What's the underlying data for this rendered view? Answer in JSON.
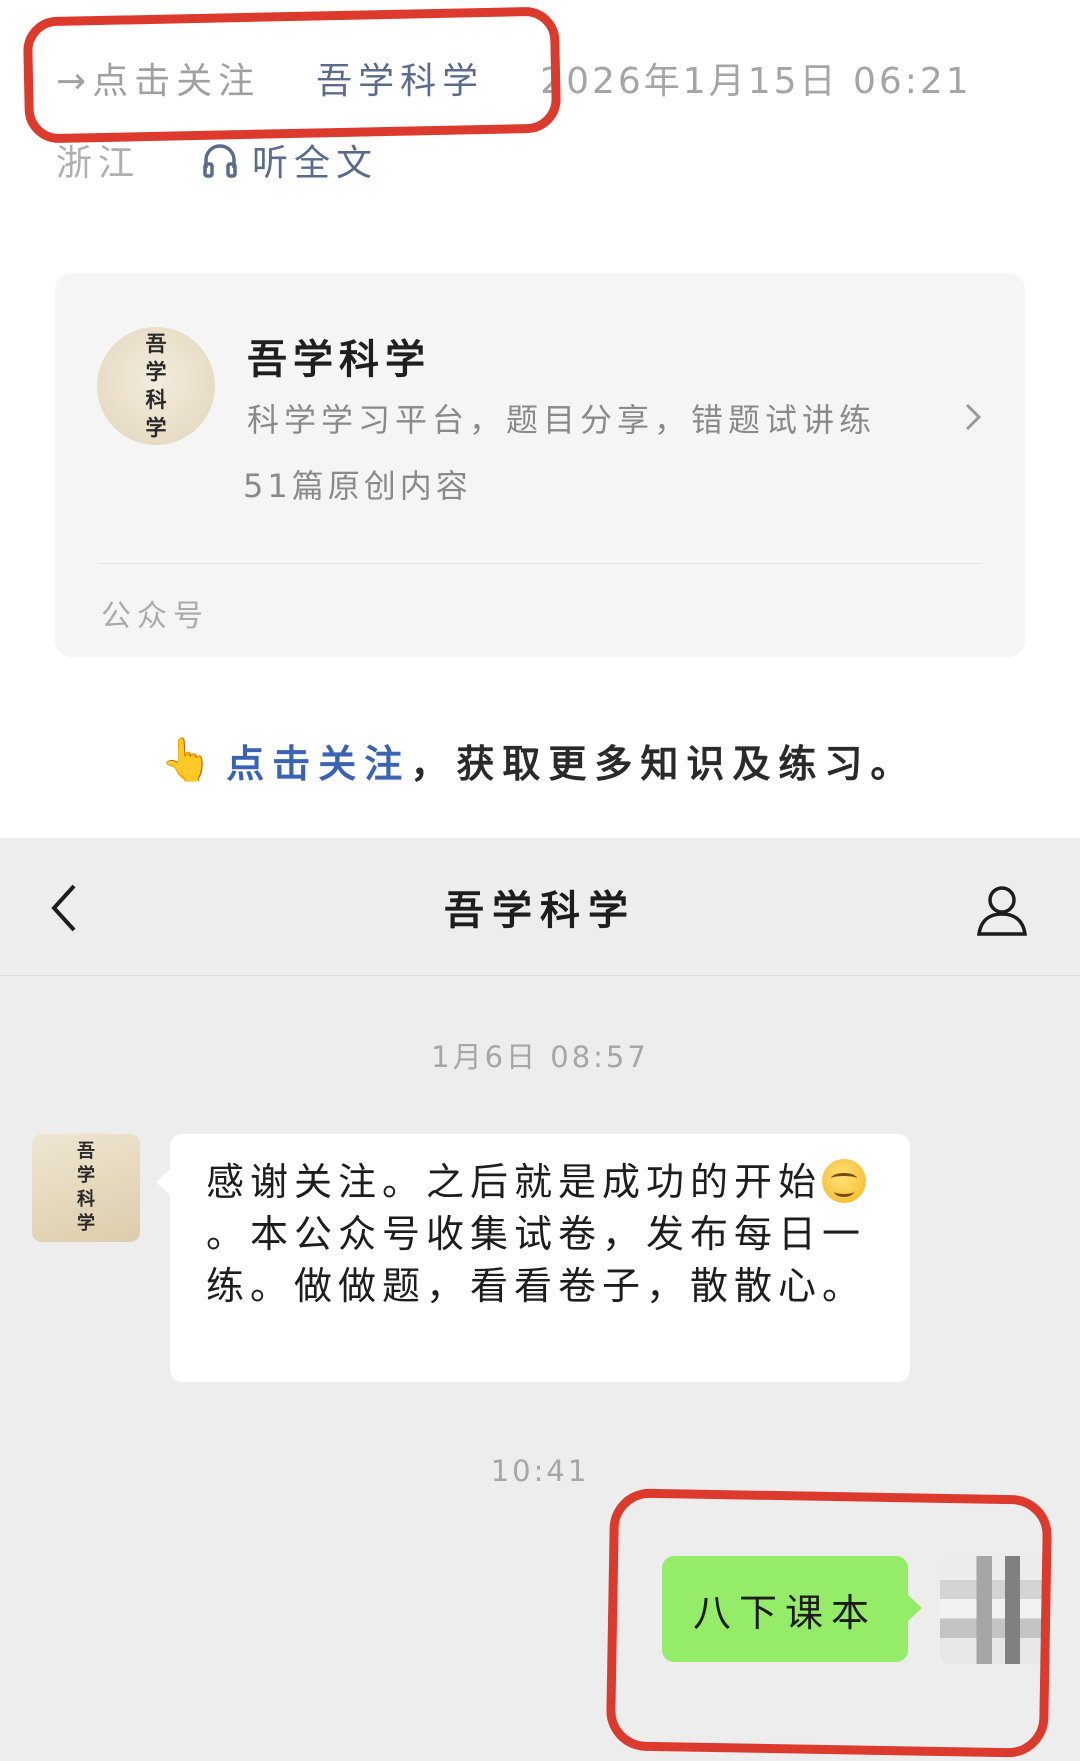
{
  "article": {
    "follow_link": "→点击关注",
    "account_name": "吾学科学",
    "date": "2026年1月15日 06:21",
    "region": "浙江",
    "listen_label": "听全文"
  },
  "card": {
    "avatar_chars": [
      "吾",
      "学",
      "科",
      "学"
    ],
    "name": "吾学科学",
    "description": "科学学习平台，题目分享，错题试讲练",
    "count": "51篇原创内容",
    "type": "公众号"
  },
  "cta": {
    "hand": "👆",
    "link": "点击关注",
    "rest": "，获取更多知识及练习。"
  },
  "chat": {
    "title": "吾学科学",
    "timestamp1": "1月6日 08:57",
    "incoming_part1": "感谢关注。之后就是成功的开始",
    "incoming_part2": "。本公众号收集试卷，发布每日一练。做做题，看看卷子，散散心。",
    "timestamp2": "10:41",
    "outgoing": "八下课本"
  },
  "colors": {
    "annotation_red": "#dd3a2e",
    "link_blue": "#3a63b3",
    "outgoing_bubble": "#95ec69",
    "chat_bg": "#ededed"
  },
  "icons": [
    "arrow-right-icon",
    "headphones-icon",
    "chevron-right-icon",
    "back-chevron-icon",
    "person-icon",
    "pointing-hand-emoji",
    "smirk-emoji"
  ]
}
